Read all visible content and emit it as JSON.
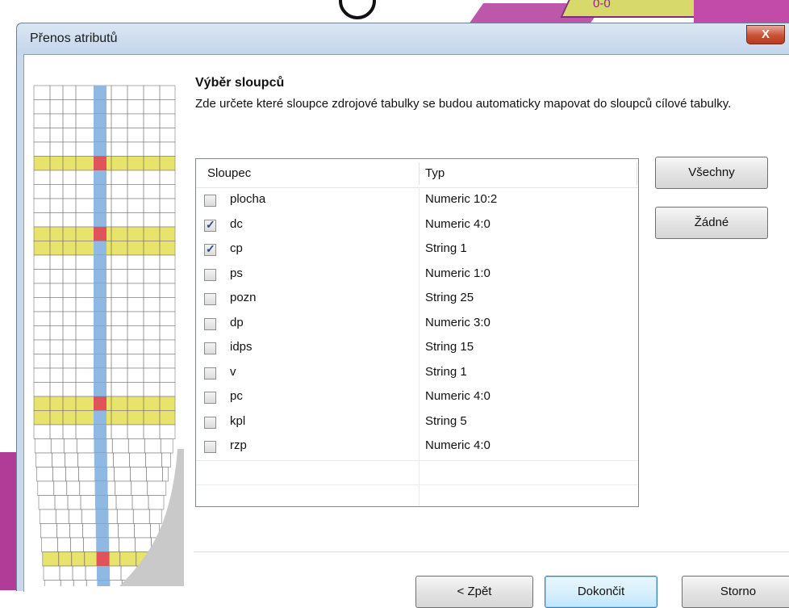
{
  "window": {
    "title": "Přenos atributů",
    "close_label": "X"
  },
  "background": {
    "map_label": "0-0"
  },
  "page": {
    "section_title": "Výběr sloupců",
    "section_desc": "Zde určete které sloupce zdrojové tabulky se budou automaticky mapovat do sloupců cílové tabulky."
  },
  "list": {
    "headers": {
      "col1": "Sloupec",
      "col2": "Typ"
    },
    "rows": [
      {
        "name": "plocha",
        "type": "Numeric 10:2",
        "checked": false
      },
      {
        "name": "dc",
        "type": "Numeric 4:0",
        "checked": true
      },
      {
        "name": "cp",
        "type": "String 1",
        "checked": true
      },
      {
        "name": "ps",
        "type": "Numeric 1:0",
        "checked": false
      },
      {
        "name": "pozn",
        "type": "String 25",
        "checked": false
      },
      {
        "name": "dp",
        "type": "Numeric 3:0",
        "checked": false
      },
      {
        "name": "idps",
        "type": "String 15",
        "checked": false
      },
      {
        "name": "v",
        "type": "String 1",
        "checked": false
      },
      {
        "name": "pc",
        "type": "Numeric 4:0",
        "checked": false
      },
      {
        "name": "kpl",
        "type": "String 5",
        "checked": false
      },
      {
        "name": "rzp",
        "type": "Numeric 4:0",
        "checked": false
      }
    ]
  },
  "buttons": {
    "all": "Všechny",
    "none": "Žádné",
    "back": "< Zpět",
    "finish": "Dokončit",
    "cancel": "Storno"
  },
  "colors": {
    "yellow_row": "#e8e36a",
    "blue_col": "#8fb9e3",
    "red_cell": "#e0535a"
  }
}
